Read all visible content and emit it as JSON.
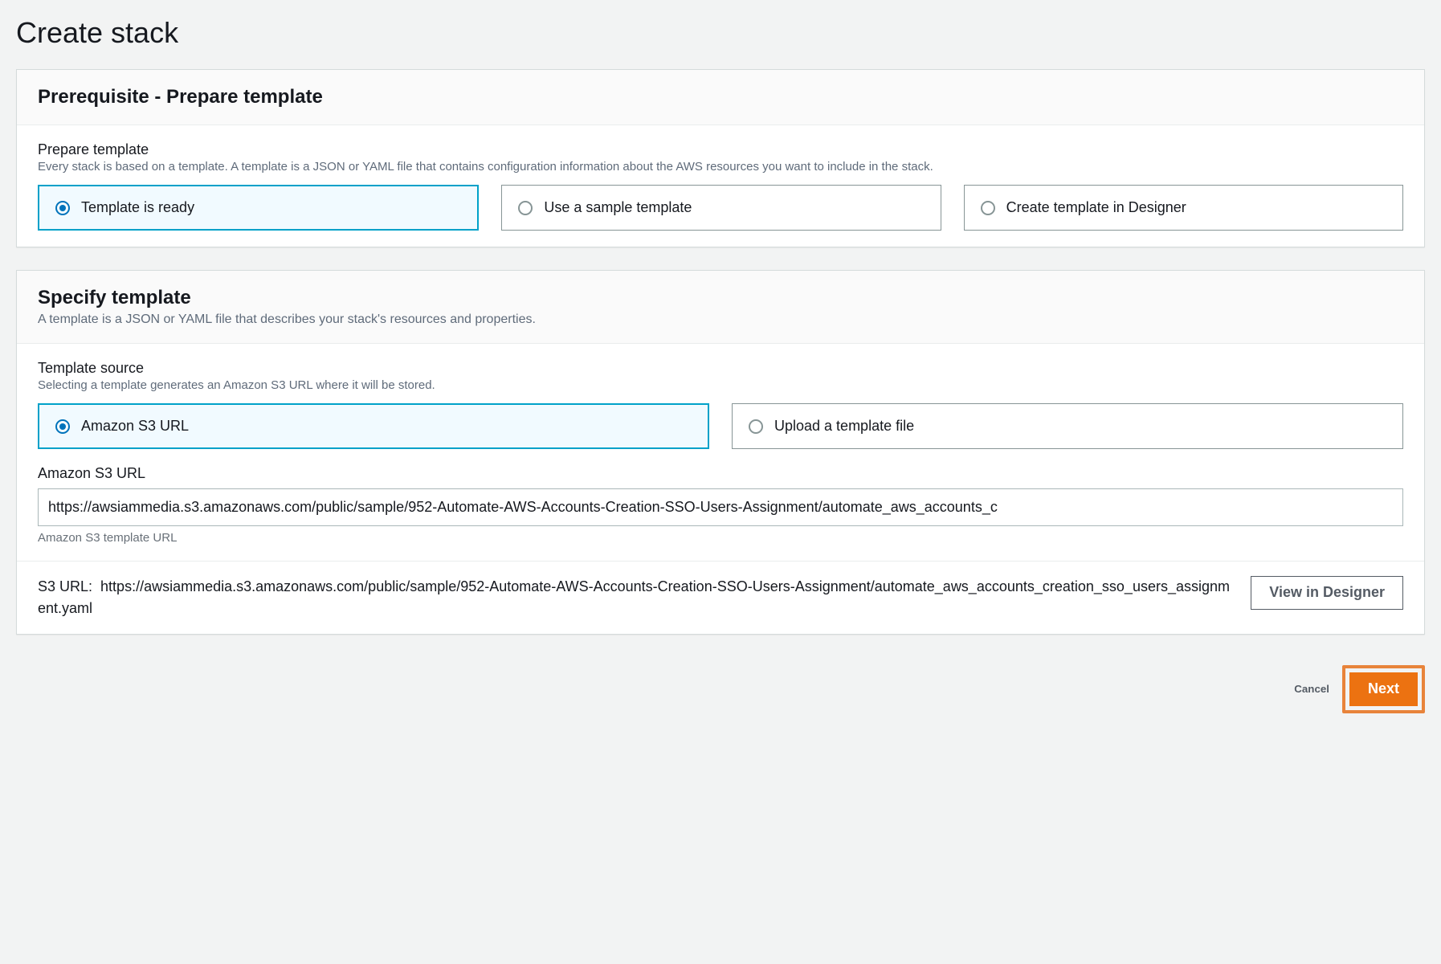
{
  "page": {
    "title": "Create stack"
  },
  "prerequisite": {
    "panel_title": "Prerequisite - Prepare template",
    "label": "Prepare template",
    "description": "Every stack is based on a template. A template is a JSON or YAML file that contains configuration information about the AWS resources you want to include in the stack.",
    "options": {
      "ready": "Template is ready",
      "sample": "Use a sample template",
      "designer": "Create template in Designer"
    }
  },
  "specify": {
    "panel_title": "Specify template",
    "panel_subtitle": "A template is a JSON or YAML file that describes your stack's resources and properties.",
    "source_label": "Template source",
    "source_description": "Selecting a template generates an Amazon S3 URL where it will be stored.",
    "options": {
      "s3": "Amazon S3 URL",
      "upload": "Upload a template file"
    },
    "url_label": "Amazon S3 URL",
    "url_value": "https://awsiammedia.s3.amazonaws.com/public/sample/952-Automate-AWS-Accounts-Creation-SSO-Users-Assignment/automate_aws_accounts_c",
    "url_hint": "Amazon S3 template URL",
    "s3_display_label": "S3 URL:",
    "s3_display_value": "https://awsiammedia.s3.amazonaws.com/public/sample/952-Automate-AWS-Accounts-Creation-SSO-Users-Assignment/automate_aws_accounts_creation_sso_users_assignment.yaml",
    "view_in_designer": "View in Designer"
  },
  "actions": {
    "cancel": "Cancel",
    "next": "Next"
  }
}
